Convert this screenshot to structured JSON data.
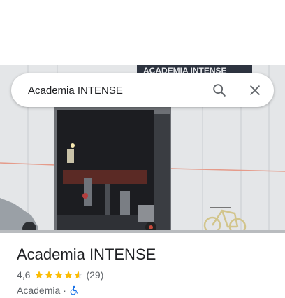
{
  "search": {
    "value": "Academia INTENSE",
    "search_icon": "search-icon",
    "close_icon": "close-icon"
  },
  "photo": {
    "sign_text": "ACADEMIA INTENSE"
  },
  "place": {
    "title": "Academia INTENSE",
    "rating": "4,6",
    "rating_value": 4.6,
    "star_count": 5,
    "reviews": "(29)",
    "category": "Academia",
    "separator": "·",
    "accessibility_icon": "wheelchair-icon"
  },
  "colors": {
    "star": "#fbbc04",
    "accessibility": "#1a73e8",
    "text_primary": "#202124",
    "text_secondary": "#5f6368"
  }
}
